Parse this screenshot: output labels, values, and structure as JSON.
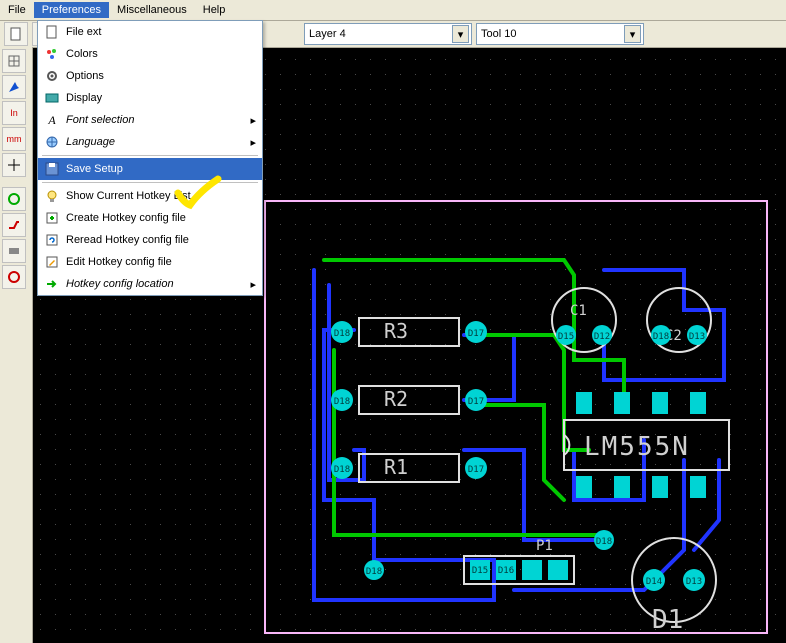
{
  "menubar": {
    "file": "File",
    "preferences": "Preferences",
    "misc": "Miscellaneous",
    "help": "Help"
  },
  "toolbar": {
    "layer_value": "Layer 4",
    "tool_value": "Tool 10"
  },
  "dropdown": {
    "file_ext": "File ext",
    "colors": "Colors",
    "options": "Options",
    "display": "Display",
    "font_selection": "Font selection",
    "language": "Language",
    "save_setup": "Save Setup",
    "show_hotkey_list": "Show Current Hotkey List",
    "create_hotkey": "Create Hotkey config file",
    "reread_hotkey": "Reread Hotkey config file",
    "edit_hotkey": "Edit Hotkey config file",
    "hotkey_location": "Hotkey config location"
  },
  "pcb": {
    "components": {
      "r1": "R1",
      "r2": "R2",
      "r3": "R3",
      "c1": "C1",
      "c2": "C2",
      "d1": "D1",
      "ic": "LM555N",
      "p1": "P1"
    },
    "pads": [
      "D18",
      "D17",
      "D18",
      "D17",
      "D18",
      "D17",
      "D15",
      "D12",
      "D18",
      "D13",
      "D14",
      "D13",
      "D15",
      "D16"
    ]
  },
  "colors": {
    "highlight": "#ffe600",
    "menu_select_bg": "#316ac5"
  }
}
